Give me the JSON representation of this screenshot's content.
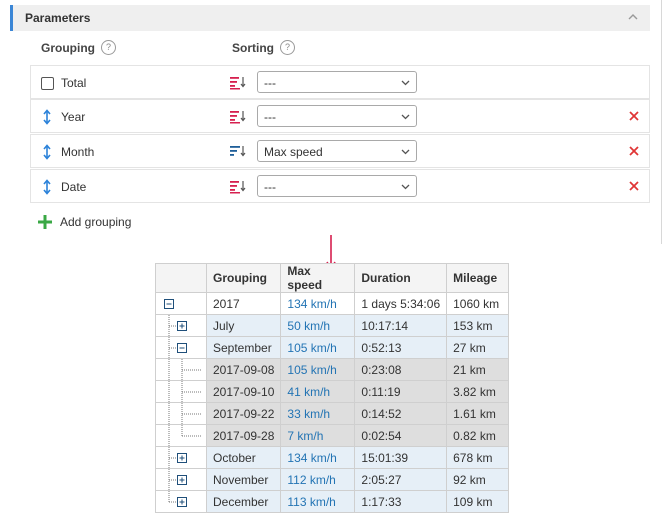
{
  "panel": {
    "title": "Parameters",
    "columns": {
      "grouping": "Grouping",
      "sorting": "Sorting"
    },
    "rows": [
      {
        "name": "Total",
        "sort": "---",
        "sort_state": "descending-red",
        "removable": false,
        "has_checkbox": true
      },
      {
        "name": "Year",
        "sort": "---",
        "sort_state": "descending-red",
        "removable": true,
        "has_checkbox": false
      },
      {
        "name": "Month",
        "sort": "Max speed",
        "sort_state": "descending-blue",
        "removable": true,
        "has_checkbox": false
      },
      {
        "name": "Date",
        "sort": "---",
        "sort_state": "descending-red",
        "removable": true,
        "has_checkbox": false
      }
    ],
    "add_label": "Add grouping",
    "help_glyph": "?"
  },
  "table": {
    "headers": [
      "Grouping",
      "Max speed",
      "Duration",
      "Mileage"
    ],
    "rows": [
      {
        "group": "2017",
        "speed": "134 km/h",
        "duration": "1 days 5:34:06",
        "mileage": "1060 km"
      },
      {
        "group": "July",
        "speed": "50 km/h",
        "duration": "10:17:14",
        "mileage": "153 km"
      },
      {
        "group": "September",
        "speed": "105 km/h",
        "duration": "0:52:13",
        "mileage": "27 km"
      },
      {
        "group": "2017-09-08",
        "speed": "105 km/h",
        "duration": "0:23:08",
        "mileage": "21 km"
      },
      {
        "group": "2017-09-10",
        "speed": "41 km/h",
        "duration": "0:11:19",
        "mileage": "3.82 km"
      },
      {
        "group": "2017-09-22",
        "speed": "33 km/h",
        "duration": "0:14:52",
        "mileage": "1.61 km"
      },
      {
        "group": "2017-09-28",
        "speed": "7 km/h",
        "duration": "0:02:54",
        "mileage": "0.82 km"
      },
      {
        "group": "October",
        "speed": "134 km/h",
        "duration": "15:01:39",
        "mileage": "678 km"
      },
      {
        "group": "November",
        "speed": "112 km/h",
        "duration": "2:05:27",
        "mileage": "92 km"
      },
      {
        "group": "December",
        "speed": "113 km/h",
        "duration": "1:17:33",
        "mileage": "109 km"
      }
    ]
  },
  "colors": {
    "accent": "#3b86d6",
    "remove": "#e03535",
    "add": "#3aa845",
    "link": "#2374b4",
    "arrow": "#d6204f"
  }
}
